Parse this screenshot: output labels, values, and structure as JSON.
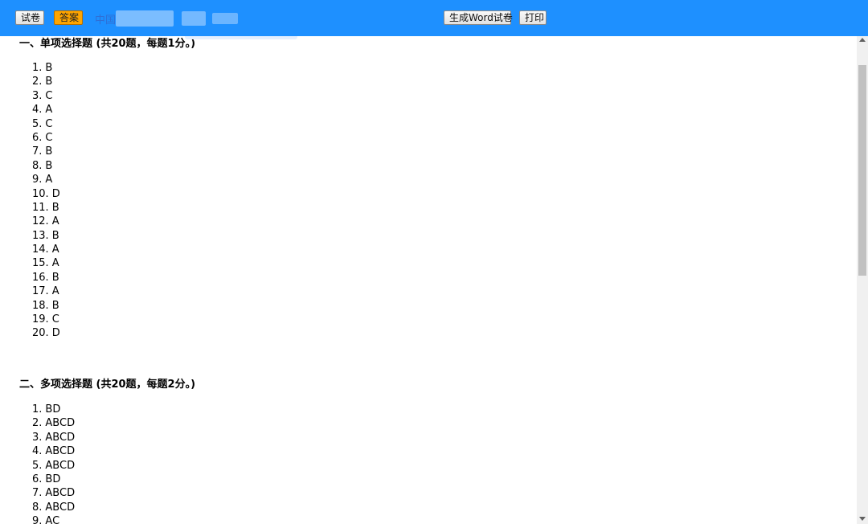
{
  "toolbar": {
    "paper_label": "试卷",
    "answer_label": "答案",
    "title_visible": "中国",
    "generate_word_label": "生成Word试卷",
    "print_label": "打印",
    "bar_color": "#1e90ff",
    "active_color": "#ffa500"
  },
  "sections": [
    {
      "title": "一、单项选择题 (共20题，每题1分。)",
      "answers": [
        {
          "num": "1.",
          "ans": "B"
        },
        {
          "num": "2.",
          "ans": "B"
        },
        {
          "num": "3.",
          "ans": "C"
        },
        {
          "num": "4.",
          "ans": "A"
        },
        {
          "num": "5.",
          "ans": "C"
        },
        {
          "num": "6.",
          "ans": "C"
        },
        {
          "num": "7.",
          "ans": "B"
        },
        {
          "num": "8.",
          "ans": "B"
        },
        {
          "num": "9.",
          "ans": "A"
        },
        {
          "num": "10.",
          "ans": "D"
        },
        {
          "num": "11.",
          "ans": "B"
        },
        {
          "num": "12.",
          "ans": "A"
        },
        {
          "num": "13.",
          "ans": "B"
        },
        {
          "num": "14.",
          "ans": "A"
        },
        {
          "num": "15.",
          "ans": "A"
        },
        {
          "num": "16.",
          "ans": "B"
        },
        {
          "num": "17.",
          "ans": "A"
        },
        {
          "num": "18.",
          "ans": "B"
        },
        {
          "num": "19.",
          "ans": "C"
        },
        {
          "num": "20.",
          "ans": "D"
        }
      ]
    },
    {
      "title": "二、多项选择题 (共20题，每题2分。)",
      "answers": [
        {
          "num": "1.",
          "ans": "BD"
        },
        {
          "num": "2.",
          "ans": "ABCD"
        },
        {
          "num": "3.",
          "ans": "ABCD"
        },
        {
          "num": "4.",
          "ans": "ABCD"
        },
        {
          "num": "5.",
          "ans": "ABCD"
        },
        {
          "num": "6.",
          "ans": "BD"
        },
        {
          "num": "7.",
          "ans": "ABCD"
        },
        {
          "num": "8.",
          "ans": "ABCD"
        },
        {
          "num": "9.",
          "ans": "AC"
        }
      ]
    }
  ]
}
